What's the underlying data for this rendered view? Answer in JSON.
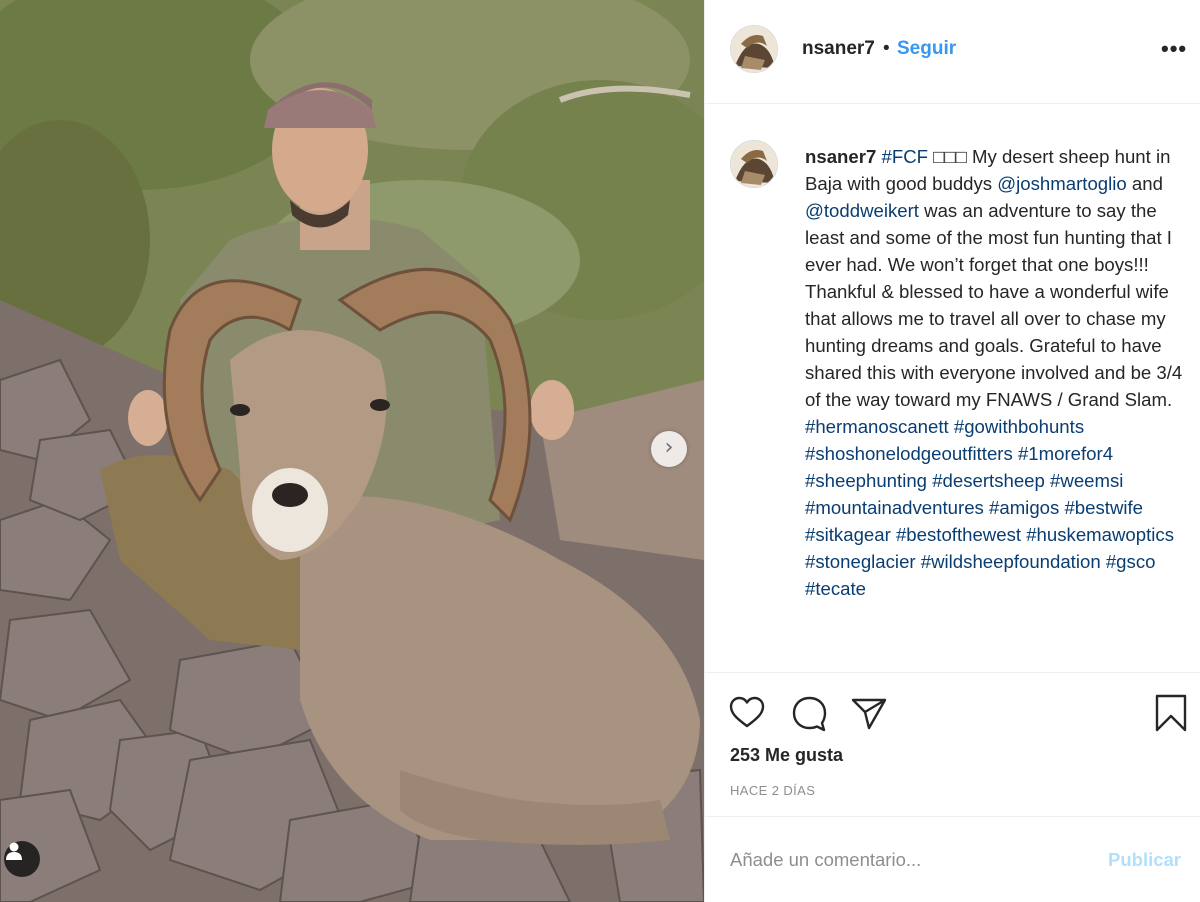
{
  "post": {
    "username": "nsaner7",
    "separator": "•",
    "follow_label": "Seguir",
    "more_label": "•••",
    "carousel_next": "›"
  },
  "caption": {
    "username": "nsaner7",
    "segments": [
      {
        "type": "link",
        "text": "#FCF"
      },
      {
        "type": "text",
        "text": " □□□ My desert sheep hunt in Baja with good buddys "
      },
      {
        "type": "link",
        "text": "@joshmartoglio"
      },
      {
        "type": "text",
        "text": " and "
      },
      {
        "type": "link",
        "text": "@toddweikert"
      },
      {
        "type": "text",
        "text": " was an adventure to say the least and some of the most fun hunting that I ever had. We won’t forget that one boys!!! Thankful & blessed to have a wonderful wife that allows me to travel all over to chase my hunting dreams and goals. Grateful to have shared this with everyone involved and be 3/4 of the way toward my FNAWS / Grand Slam. "
      },
      {
        "type": "link",
        "text": "#hermanoscanett"
      },
      {
        "type": "text",
        "text": " "
      },
      {
        "type": "link",
        "text": "#gowithbohunts"
      },
      {
        "type": "text",
        "text": " "
      },
      {
        "type": "link",
        "text": "#shoshonelodgeoutfitters"
      },
      {
        "type": "text",
        "text": " "
      },
      {
        "type": "link",
        "text": "#1morefor4"
      },
      {
        "type": "text",
        "text": " "
      },
      {
        "type": "link",
        "text": "#sheephunting"
      },
      {
        "type": "text",
        "text": " "
      },
      {
        "type": "link",
        "text": "#desertsheep"
      },
      {
        "type": "text",
        "text": " "
      },
      {
        "type": "link",
        "text": "#weemsi"
      },
      {
        "type": "text",
        "text": " "
      },
      {
        "type": "link",
        "text": "#mountainadventures"
      },
      {
        "type": "text",
        "text": " "
      },
      {
        "type": "link",
        "text": "#amigos"
      },
      {
        "type": "text",
        "text": " "
      },
      {
        "type": "link",
        "text": "#bestwife"
      },
      {
        "type": "text",
        "text": " "
      },
      {
        "type": "link",
        "text": "#sitkagear"
      },
      {
        "type": "text",
        "text": " "
      },
      {
        "type": "link",
        "text": "#bestofthewest"
      },
      {
        "type": "text",
        "text": " "
      },
      {
        "type": "link",
        "text": "#huskemawoptics"
      },
      {
        "type": "text",
        "text": " "
      },
      {
        "type": "link",
        "text": "#stoneglacier"
      },
      {
        "type": "text",
        "text": " "
      },
      {
        "type": "link",
        "text": "#wildsheepfoundation"
      },
      {
        "type": "text",
        "text": " "
      },
      {
        "type": "link",
        "text": "#gsco"
      },
      {
        "type": "text",
        "text": " "
      },
      {
        "type": "link",
        "text": "#tecate"
      }
    ]
  },
  "actions": {
    "like_icon": "heart-icon",
    "comment_icon": "speech-bubble-icon",
    "share_icon": "paper-plane-icon",
    "save_icon": "bookmark-icon"
  },
  "likes_text": "253 Me gusta",
  "timestamp": "HACE 2 DÍAS",
  "comment": {
    "placeholder": "Añade un comentario...",
    "publish_label": "Publicar"
  },
  "colors": {
    "link": "#0a3d71",
    "follow": "#3897f0",
    "publish_disabled": "#b2dffc",
    "muted": "#8e8e8e"
  }
}
